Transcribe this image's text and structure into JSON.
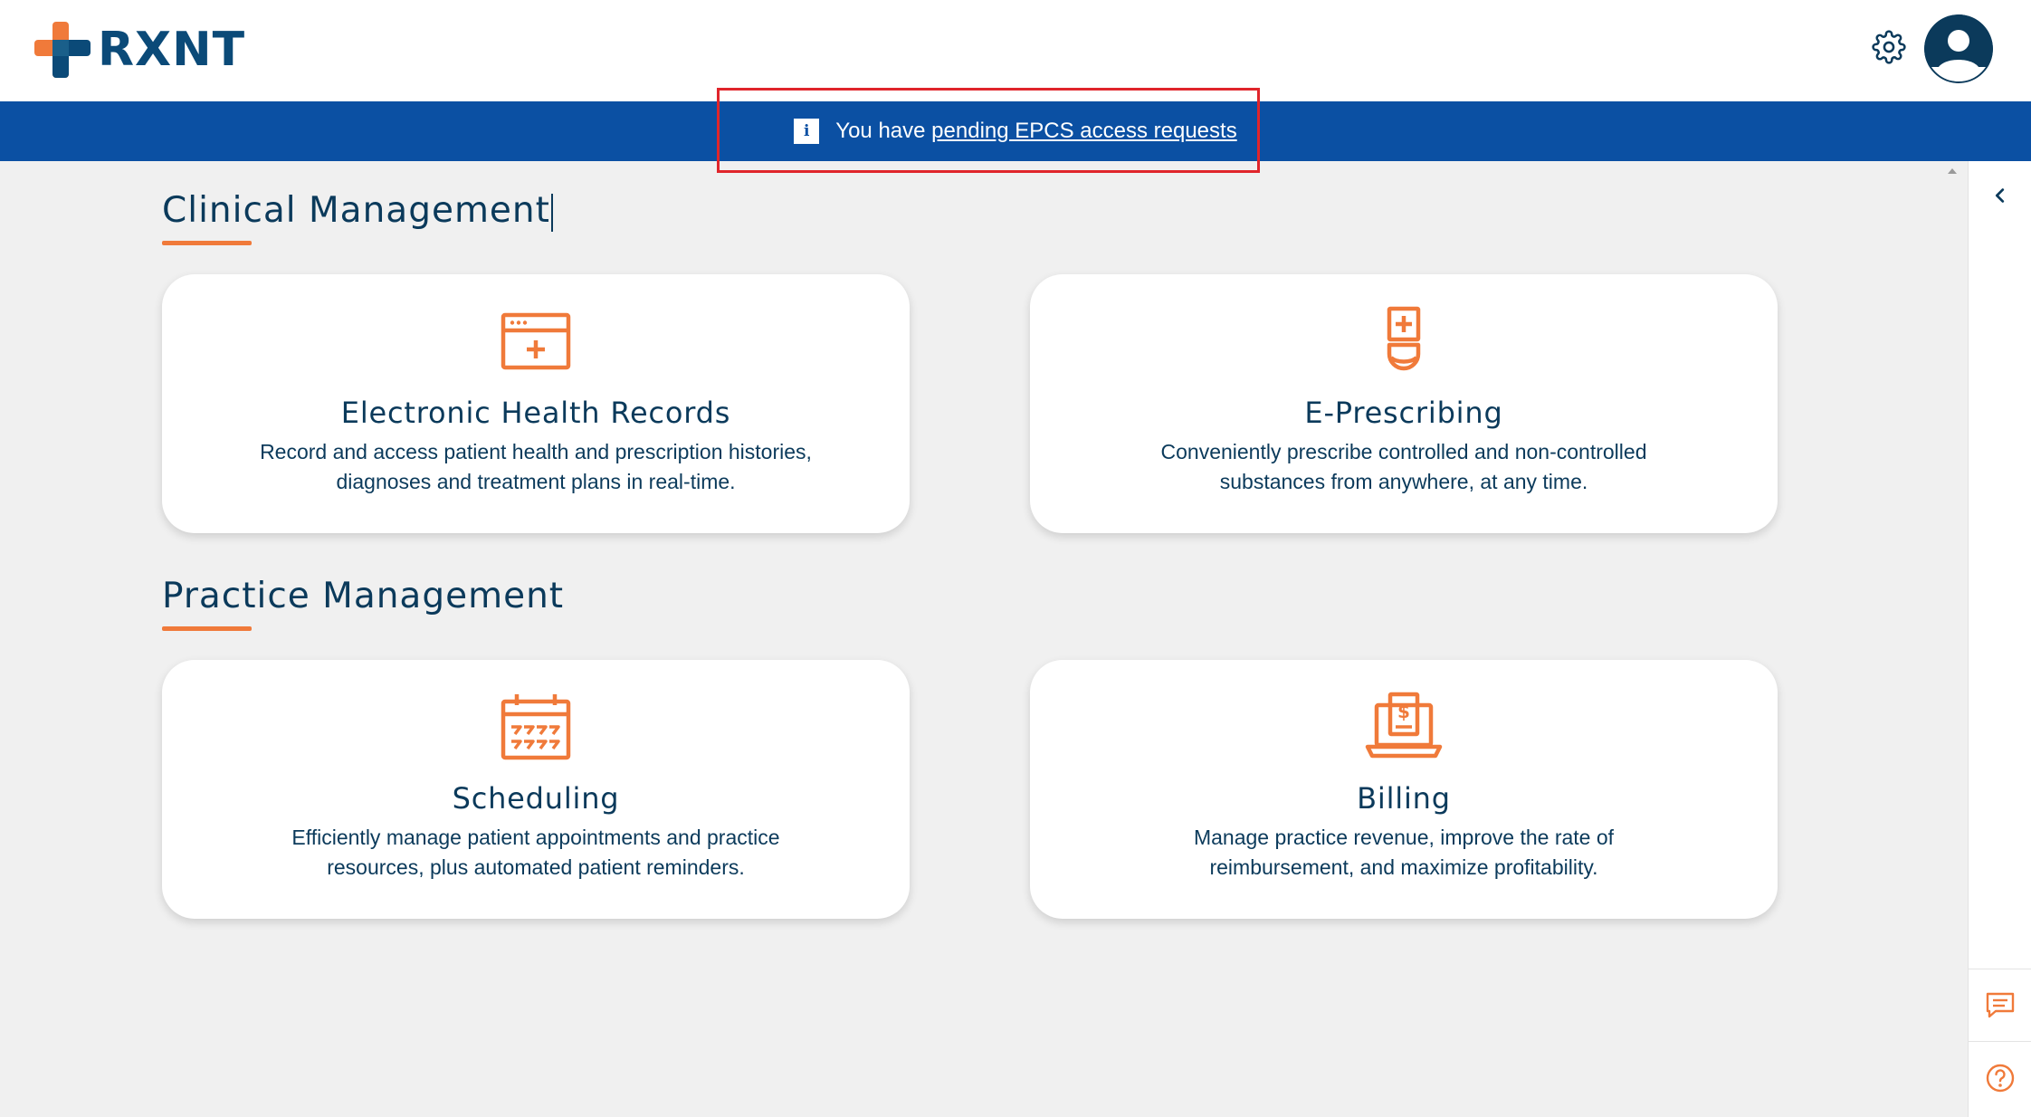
{
  "app": {
    "logo_text": "RXNT"
  },
  "header": {
    "settings_icon": "gear-icon",
    "profile_icon": "user-avatar-icon"
  },
  "banner": {
    "prefix": "You have",
    "link_text": "pending EPCS access requests",
    "info_glyph": "i"
  },
  "sections": [
    {
      "title": "Clinical Management",
      "cards": [
        {
          "title": "Electronic Health Records",
          "desc_line1": "Record and access patient health and prescription histories,",
          "desc_line2": "diagnoses and treatment plans in real-time.",
          "icon": "medical-record-icon"
        },
        {
          "title": "E-Prescribing",
          "desc_line1": "Conveniently prescribe controlled and non-controlled",
          "desc_line2": "substances from anywhere, at any time.",
          "icon": "prescription-bottle-icon"
        }
      ]
    },
    {
      "title": "Practice Management",
      "cards": [
        {
          "title": "Scheduling",
          "desc_line1": "Efficiently manage patient appointments and practice",
          "desc_line2": "resources, plus automated patient reminders.",
          "icon": "calendar-icon"
        },
        {
          "title": "Billing",
          "desc_line1": "Manage practice revenue, improve the rate of",
          "desc_line2": "reimbursement, and maximize profitability.",
          "icon": "billing-laptop-icon"
        }
      ]
    }
  ],
  "right_rail": {
    "collapse_icon": "chevron-left-icon",
    "chat_icon": "chat-icon",
    "help_icon": "help-icon"
  },
  "colors": {
    "brand_blue": "#0b50a3",
    "brand_navy": "#0b3a5b",
    "accent_orange": "#f07a3a",
    "highlight_red": "#e0252b"
  }
}
